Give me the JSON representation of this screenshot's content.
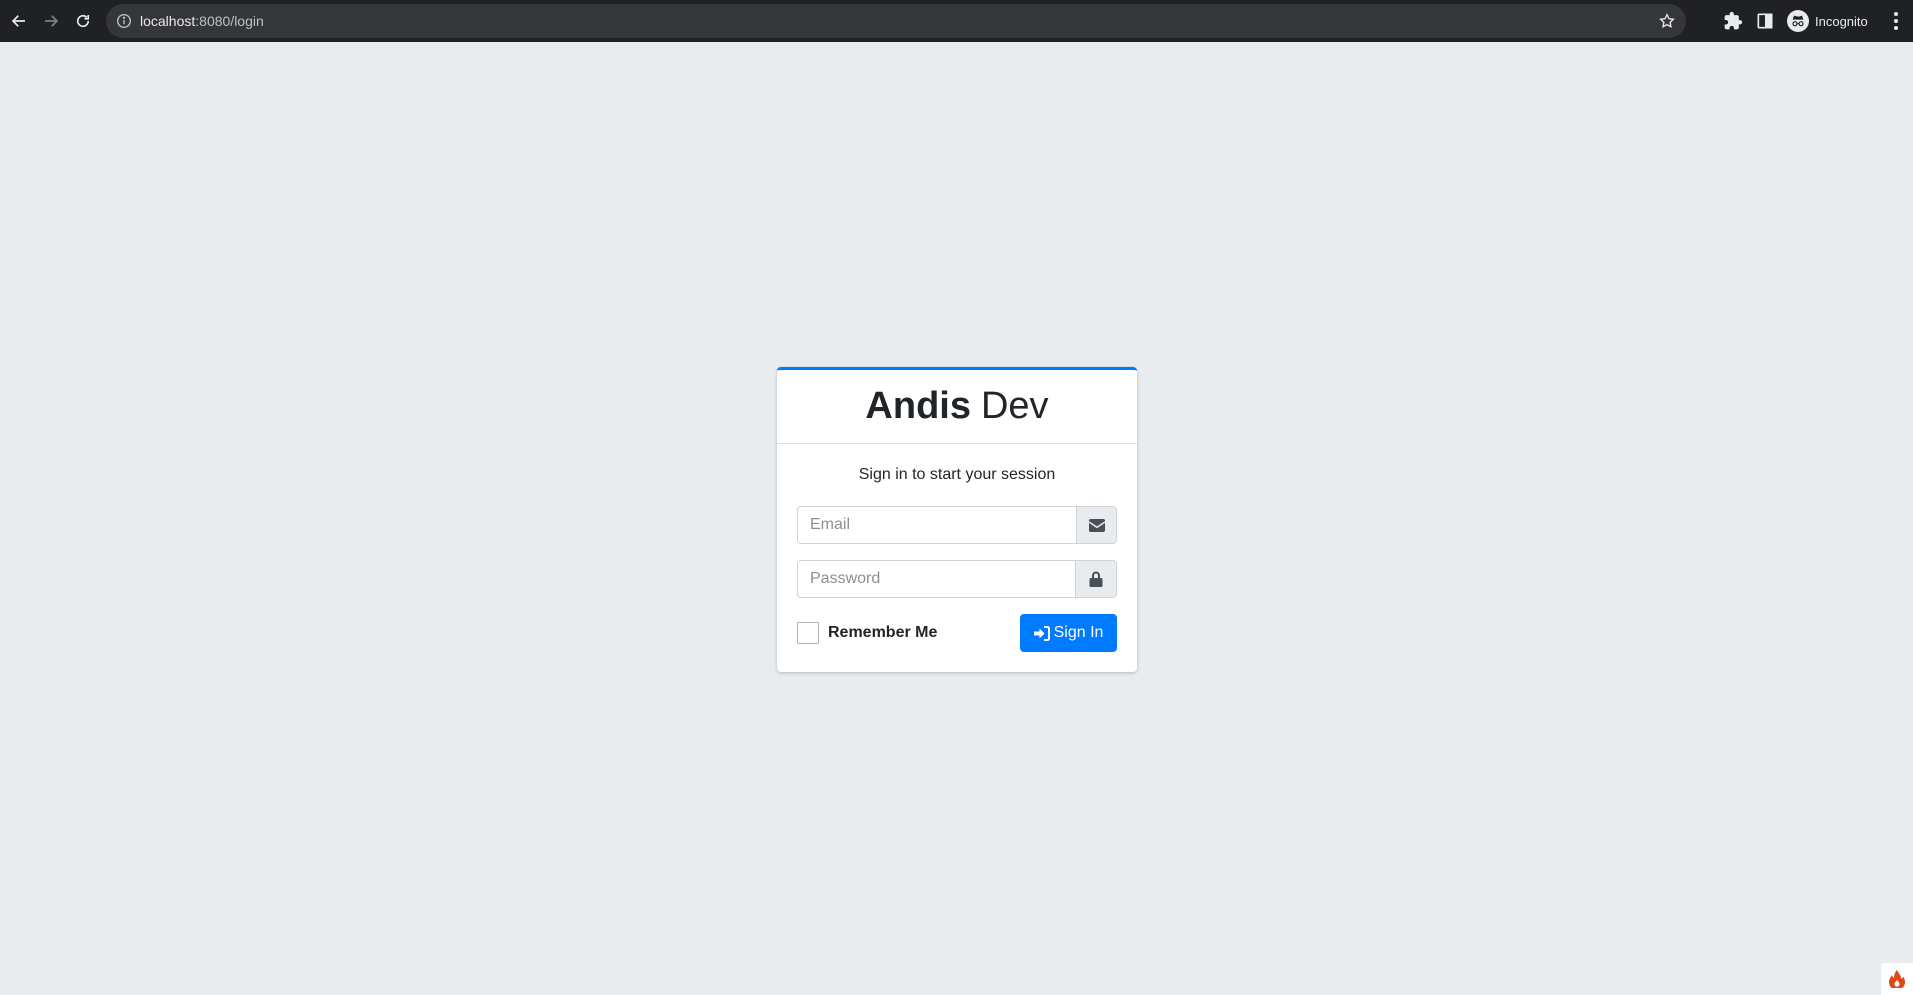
{
  "browser": {
    "url_host": "localhost",
    "url_path": ":8080/login",
    "profile_label": "Incognito"
  },
  "login": {
    "brand_bold": "Andis",
    "brand_light": "Dev",
    "message": "Sign in to start your session",
    "email_placeholder": "Email",
    "email_value": "",
    "password_placeholder": "Password",
    "password_value": "",
    "remember_label": "Remember Me",
    "remember_checked": false,
    "signin_label": "Sign In"
  },
  "colors": {
    "primary": "#007bff",
    "page_bg": "#e9ecef",
    "chrome_bg": "#202124"
  },
  "icons": {
    "email_addon": "envelope-icon",
    "password_addon": "lock-icon",
    "signin": "sign-in-icon",
    "debug": "flame-icon"
  }
}
